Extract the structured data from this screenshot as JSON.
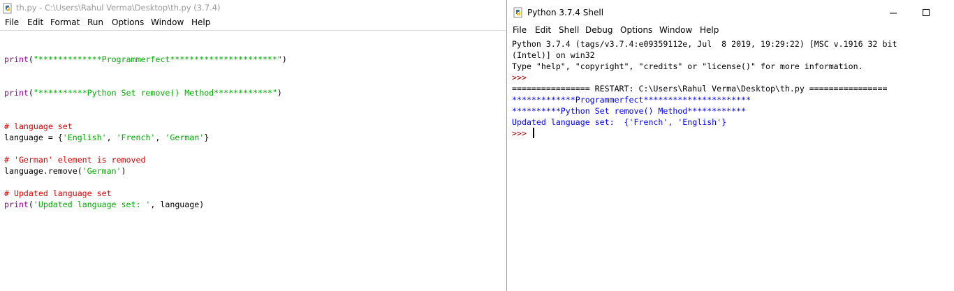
{
  "editor": {
    "title": "th.py - C:\\Users\\Rahul Verma\\Desktop\\th.py (3.7.4)",
    "menu": [
      "File",
      "Edit",
      "Format",
      "Run",
      "Options",
      "Window",
      "Help"
    ],
    "code": [
      {
        "kw": "print",
        "rest_plain": "(",
        "str": "\"*************Programmerfect**********************\"",
        "end": ")"
      },
      {
        "kw": "print",
        "rest_plain": "(",
        "str": "\"**********Python Set remove() Method************\"",
        "end": ")"
      },
      {
        "comment": "# language set"
      },
      {
        "pre": "language = {",
        "s1": "'English'",
        "c1": ", ",
        "s2": "'French'",
        "c2": ", ",
        "s3": "'German'",
        "post": "}"
      },
      {
        "comment": "# 'German' element is removed"
      },
      {
        "pre": "language.remove(",
        "s1": "'German'",
        "post": ")"
      },
      {
        "comment": "# Updated language set"
      },
      {
        "kw": "print",
        "rest_plain": "(",
        "str": "'Updated language set: '",
        "end": ", language)"
      }
    ]
  },
  "shell": {
    "title": "Python 3.7.4 Shell",
    "menu": [
      "File",
      "Edit",
      "Shell",
      "Debug",
      "Options",
      "Window",
      "Help"
    ],
    "banner1": "Python 3.7.4 (tags/v3.7.4:e09359112e, Jul  8 2019, 19:29:22) [MSC v.1916 32 bit",
    "banner2": "(Intel)] on win32",
    "banner3": "Type \"help\", \"copyright\", \"credits\" or \"license()\" for more information.",
    "prompt": ">>>",
    "restart": "================ RESTART: C:\\Users\\Rahul Verma\\Desktop\\th.py ================",
    "out1": "*************Programmerfect**********************",
    "out2": "**********Python Set remove() Method************",
    "out3": "Updated language set:  {'French', 'English'}",
    "prompt2": ">>>"
  }
}
